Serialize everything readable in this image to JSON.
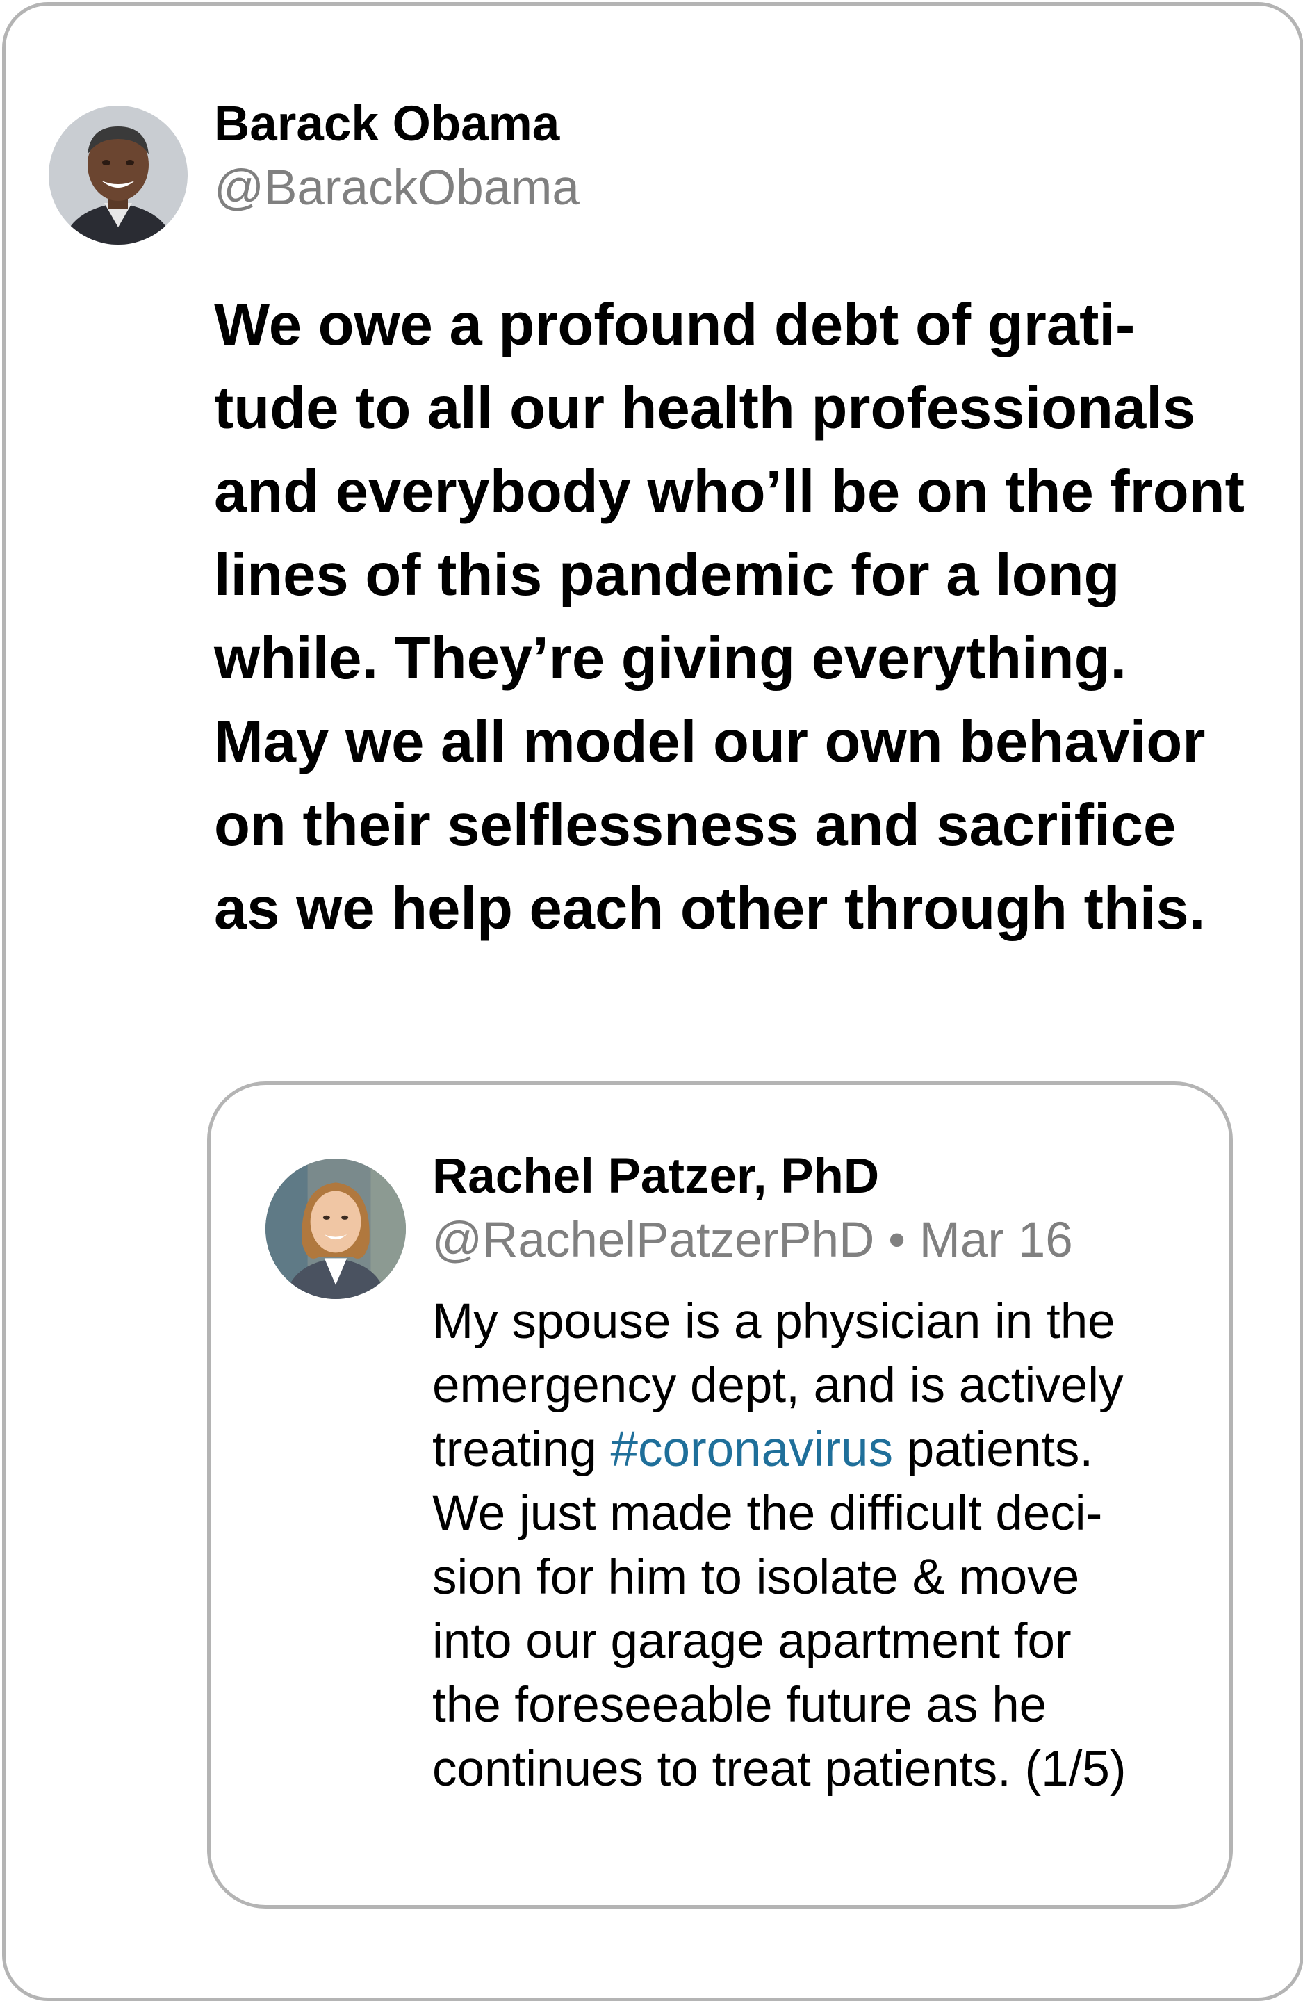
{
  "tweet": {
    "author": {
      "name": "Barack Obama",
      "handle": "@BarackObama",
      "avatar_icon": "avatar-photo-icon"
    },
    "text_lines": [
      "We owe a profound debt of grati-",
      "tude to all our health professionals",
      "and everybody who’ll be on the front",
      "lines of this pandemic for a long",
      "while. They’re giving everything.",
      "May we all model our own behavior",
      "on their selflessness and sacrifice",
      "as we help each other through this."
    ]
  },
  "quoted_tweet": {
    "author": {
      "name": "Rachel Patzer, PhD",
      "handle": "@RachelPatzerPhD",
      "separator": "•",
      "date": "Mar 16",
      "avatar_icon": "avatar-photo-icon"
    },
    "text": {
      "line1": "My spouse is a physician in the",
      "line2": "emergency dept, and is actively",
      "line3_before": "treating ",
      "line3_hashtag": "#coronavirus",
      "line3_after": " patients.",
      "line4": "We just made the difficult deci-",
      "line5": "sion for him to isolate & move",
      "line6": "into our garage apartment for",
      "line7": "the foreseeable future as he",
      "line8": "continues to treat patients. (1/5)"
    }
  },
  "colors": {
    "card_border": "#b4b4b4",
    "handle_gray": "#808080",
    "hashtag_blue": "#1f6f9a"
  }
}
